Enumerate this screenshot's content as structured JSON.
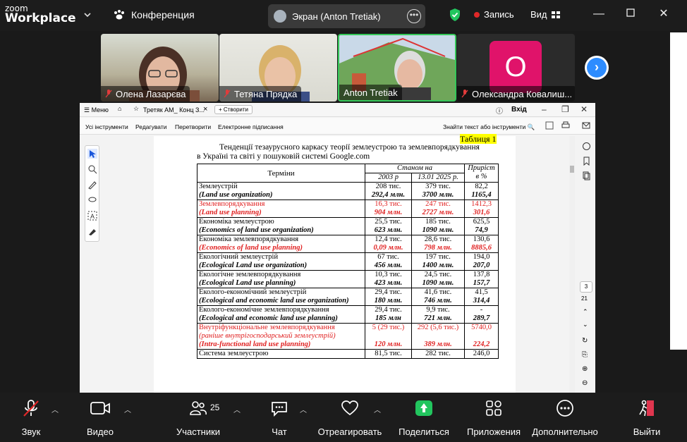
{
  "app": {
    "logo_line1": "zoom",
    "logo_line2": "Workplace",
    "conference_label": "Конференция",
    "screen_share_label": "Экран (Anton Tretiak)",
    "recording_label": "Запись",
    "view_label": "Вид"
  },
  "participants": [
    {
      "name": "Олена Лазарєва",
      "muted": true
    },
    {
      "name": "Тетяна Прядка",
      "muted": true
    },
    {
      "name": "Anton Tretiak",
      "muted": false,
      "active_speaker": true
    },
    {
      "name": "Олександра Ковалиш...",
      "muted": true,
      "avatar_letter": "О",
      "avatar_color": "#e0136a"
    }
  ],
  "acrobat": {
    "menu_label": "Меню",
    "tab_title": "Третяк АМ_ Конц З...",
    "new_tab_label": "Створити",
    "login_label": "Вхід",
    "tools": [
      "Усі інструменти",
      "Редагувати",
      "Перетворити",
      "Електронне підписання"
    ],
    "find_placeholder": "Знайти текст або інструменти",
    "page_current": "3",
    "page_total": "21"
  },
  "document": {
    "table_label": "Таблиця 1",
    "title_line1": "Тенденції тезаурусного каркасу теорії землеустрою та землевпорядкування",
    "title_line2": "в Україні та світі  у пошуковій системі Google.com",
    "headers": {
      "terms": "Терміни",
      "as_of": "Станом на",
      "year1": "2003 р",
      "year2": "13.01 2025 р.",
      "growth": "Приріст в %"
    },
    "rows": [
      {
        "ua": "Землеустрій",
        "en": "(Land use organization)",
        "v1a": "208 тис.",
        "v1b": "292,4 млн.",
        "v2a": "379 тис.",
        "v2b": "3700 млн.",
        "g1": "82,2",
        "g2": "1165,4",
        "red": false
      },
      {
        "ua": "Землевпорядкування",
        "en": "(Land use planning)",
        "v1a": "16,3 тис.",
        "v1b": "904 млн.",
        "v2a": "247 тис.",
        "v2b": "2727 млн.",
        "g1": "1412,3",
        "g2": "301,6",
        "red": true
      },
      {
        "ua": "Економіка землеустрою",
        "en": "(Economics of land use organization)",
        "v1a": "25,5 тис.",
        "v1b": "623 млн.",
        "v2a": "185 тис.",
        "v2b": "1090 млн.",
        "g1": "625,5",
        "g2": "74,9",
        "red": false
      },
      {
        "ua": "Економіка землевпорядкування",
        "en": "(Economics of land use planning)",
        "v1a": "12,4 тис.",
        "v1b": "0,09 млн.",
        "v2a": "28,6 тис.",
        "v2b": "798 млн.",
        "g1": "130,6",
        "g2": "8885,6",
        "red": false,
        "red_en": true
      },
      {
        "ua": "Екологічний землеустрій",
        "en": "(Ecological Land use organization)",
        "v1a": "67 тис.",
        "v1b": "456 млн.",
        "v2a": "197 тис.",
        "v2b": "1400 млн.",
        "g1": "194,0",
        "g2": "207,0",
        "red": false
      },
      {
        "ua": "Екологічне землевпорядкування",
        "en": " (Ecological Land use planning)",
        "v1a": "10,3 тис.",
        "v1b": "423 млн.",
        "v2a": "24,5 тис.",
        "v2b": "1090 млн.",
        "g1": "137,8",
        "g2": "157,7",
        "red": false
      },
      {
        "ua": "Еколого-економічний землеустрій",
        "en": "(Ecological and economic land use organization)",
        "v1a": "29,4 тис.",
        "v1b": "180 млн.",
        "v2a": "41,6 тис.",
        "v2b": "746 млн.",
        "g1": "41,5",
        "g2": "314,4",
        "red": false
      },
      {
        "ua": "Еколого-економічне землевпорядкування",
        "en": "(Ecological and economic land use planning)",
        "v1a": "29,4 тис.",
        "v1b": "185 млн",
        "v2a": "9,9 тис.",
        "v2b": "721 млн.",
        "g1": "-",
        "g2": "289,7",
        "red": false
      },
      {
        "ua": "Внутріфункціональне землевпорядкування",
        "note": "(раніше внутрігосподарський землеустрій)",
        "en": "(Intra-functional land use planning)",
        "v1a": "5 (29 тис.)",
        "v1b": "120 млн.",
        "v2a": "292 (5,6 тис.)",
        "v2b": "389 млн.",
        "g1": "5740,0",
        "g2": "224,2",
        "red": true
      },
      {
        "ua": "Система землеустрою",
        "en": "",
        "v1a": "81,5 тис.",
        "v1b": "",
        "v2a": "282 тис.",
        "v2b": "",
        "g1": "246,0",
        "g2": "",
        "red": false
      }
    ]
  },
  "toolbar": {
    "audio": "Звук",
    "video": "Видео",
    "participants": "Участники",
    "participants_count": "25",
    "chat": "Чат",
    "react": "Отреагировать",
    "share": "Поделиться",
    "apps": "Приложения",
    "more": "Дополнительно",
    "leave": "Выйти"
  },
  "colors": {
    "accent_green": "#22c55e",
    "accent_blue": "#2d8cff",
    "record_red": "#e02828",
    "leave_red": "#e0364f",
    "doc_red": "#e02020",
    "highlight_yellow": "#ffff00"
  }
}
